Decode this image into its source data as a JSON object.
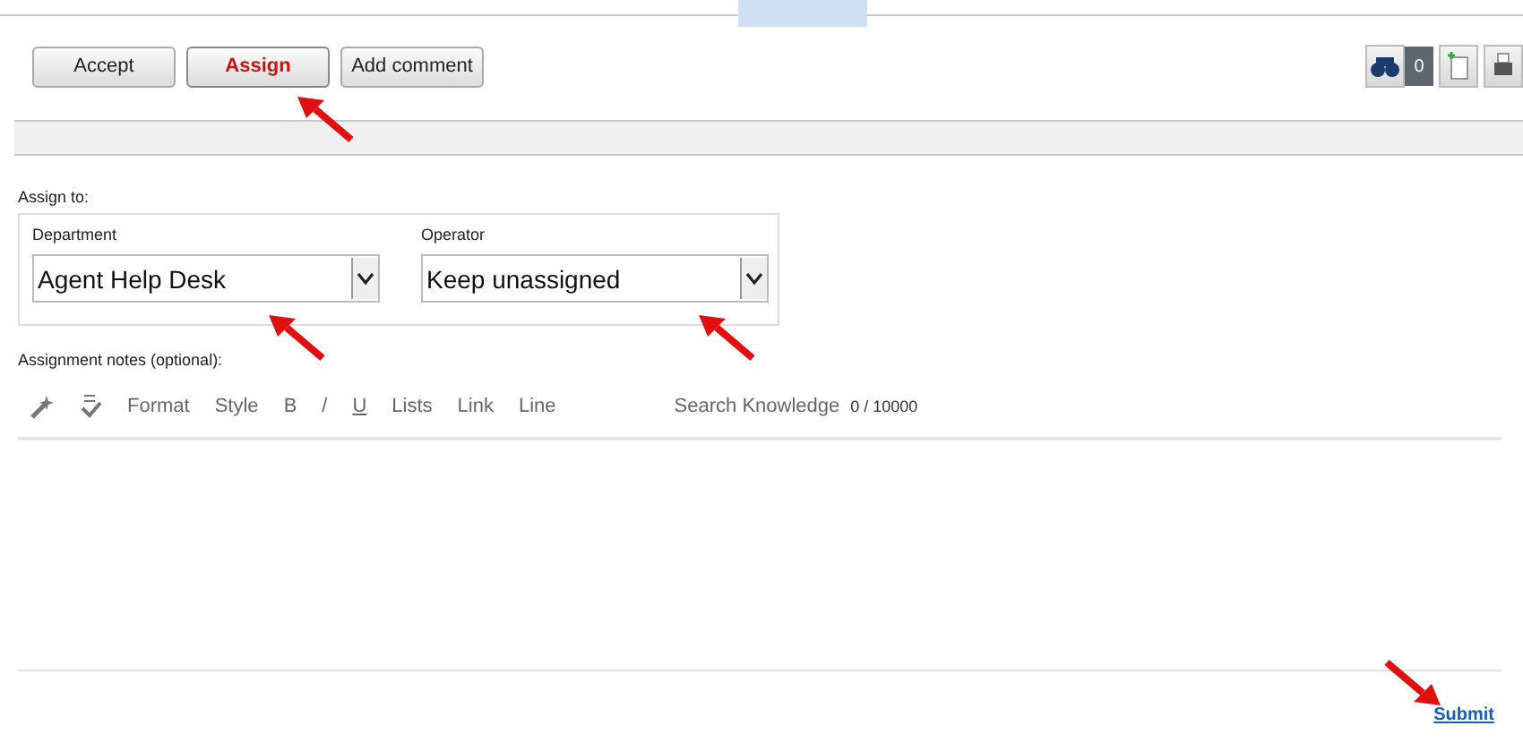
{
  "actions": [
    {
      "label": "Accept",
      "selected": false
    },
    {
      "label": "Assign",
      "selected": true
    },
    {
      "label": "Add comment",
      "selected": false
    }
  ],
  "counter": "0",
  "assign": {
    "heading": "Assign to:",
    "fields": [
      {
        "label": "Department",
        "value": "Agent Help Desk"
      },
      {
        "label": "Operator",
        "value": "Keep unassigned"
      }
    ]
  },
  "notes": {
    "label": "Assignment notes (optional):",
    "toolbar": [
      {
        "kind": "wand"
      },
      {
        "kind": "spellcheck"
      },
      {
        "kind": "text",
        "label": "Format"
      },
      {
        "kind": "text",
        "label": "Style"
      },
      {
        "kind": "text",
        "label": "B"
      },
      {
        "kind": "text",
        "label": "/"
      },
      {
        "kind": "text",
        "label": "U"
      },
      {
        "kind": "text",
        "label": "Lists"
      },
      {
        "kind": "text",
        "label": "Link"
      },
      {
        "kind": "text",
        "label": "Line"
      }
    ],
    "search": "Search Knowledge",
    "count": "0 / 10000"
  },
  "submit": "Submit"
}
